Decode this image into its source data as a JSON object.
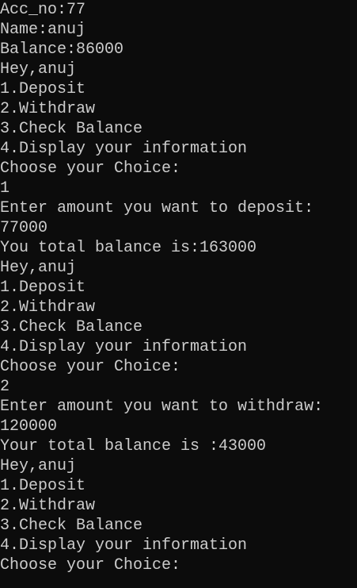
{
  "console": {
    "background": "#0c0c0c",
    "foreground": "#cccccc",
    "lines": [
      "Acc_no:77",
      "Name:anuj",
      "Balance:86000",
      "Hey,anuj",
      "1.Deposit",
      "2.Withdraw",
      "3.Check Balance",
      "4.Display your information",
      "Choose your Choice:",
      "1",
      "Enter amount you want to deposit:",
      "77000",
      "You total balance is:163000",
      "Hey,anuj",
      "1.Deposit",
      "2.Withdraw",
      "3.Check Balance",
      "4.Display your information",
      "Choose your Choice:",
      "2",
      "Enter amount you want to withdraw:",
      "120000",
      "Your total balance is :43000",
      "Hey,anuj",
      "1.Deposit",
      "2.Withdraw",
      "3.Check Balance",
      "4.Display your information",
      "Choose your Choice:"
    ]
  }
}
